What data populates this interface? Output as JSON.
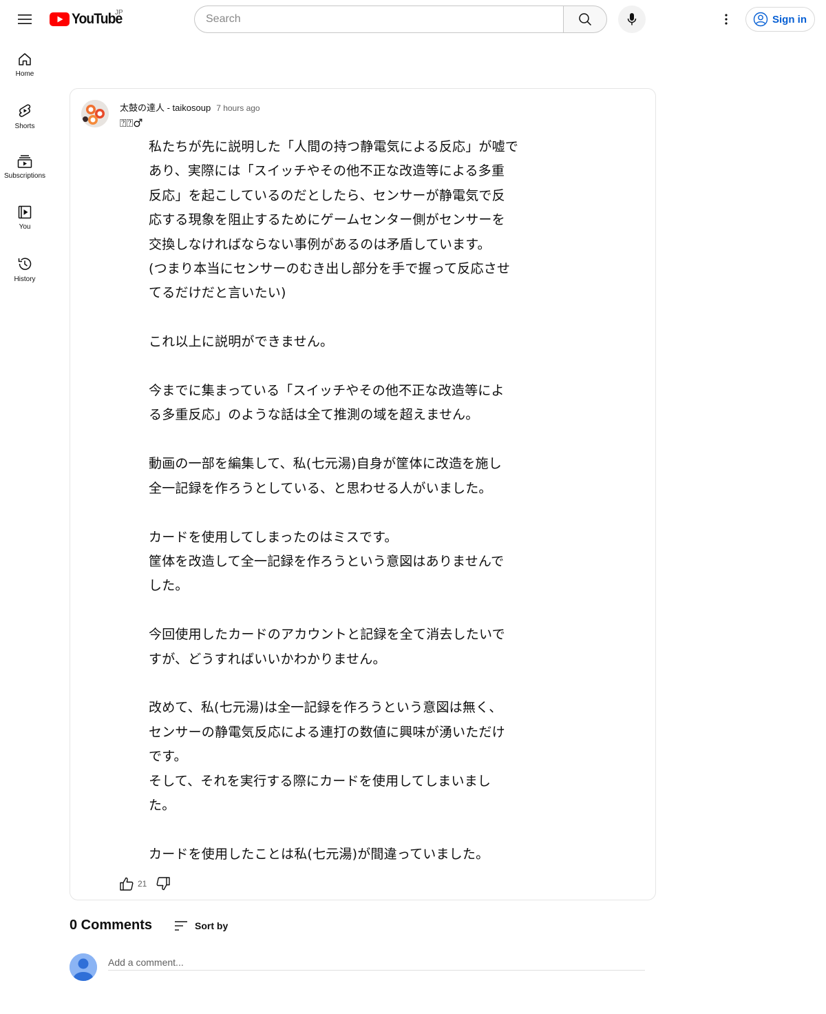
{
  "header": {
    "logo_text": "YouTube",
    "region_code": "JP",
    "search_placeholder": "Search",
    "signin_label": "Sign in"
  },
  "guide": {
    "items": [
      {
        "label": "Home",
        "icon": "home-icon"
      },
      {
        "label": "Shorts",
        "icon": "shorts-icon"
      },
      {
        "label": "Subscriptions",
        "icon": "subscriptions-icon"
      },
      {
        "label": "You",
        "icon": "you-icon"
      },
      {
        "label": "History",
        "icon": "history-icon"
      }
    ]
  },
  "post": {
    "author": "太鼓の達人 - taikosoup",
    "time": "7 hours ago",
    "emoji_line": "⍰⍰♂",
    "body": "私たちが先に説明した「人間の持つ静電気による反応」が嘘で\nあり、実際には「スイッチやその他不正な改造等による多重\n反応」を起こしているのだとしたら、センサーが静電気で反\n応する現象を阻止するためにゲームセンター側がセンサーを\n交換しなければならない事例があるのは矛盾しています。\n(つまり本当にセンサーのむき出し部分を手で握って反応させ\nてるだけだと言いたい)\n\nこれ以上に説明ができません。\n\n今までに集まっている「スイッチやその他不正な改造等によ\nる多重反応」のような話は全て推測の域を超えません。\n\n動画の一部を編集して、私(七元湯)自身が筐体に改造を施し\n全一記録を作ろうとしている、と思わせる人がいました。\n\nカードを使用してしまったのはミスです。\n筐体を改造して全一記録を作ろうという意図はありませんで\nした。\n\n今回使用したカードのアカウントと記録を全て消去したいで\nすが、どうすればいいかわかりません。\n\n改めて、私(七元湯)は全一記録を作ろうという意図は無く、\nセンサーの静電気反応による連打の数値に興味が湧いただけ\nです。\nそして、それを実行する際にカードを使用してしまいまし\nた。\n\nカードを使用したことは私(七元湯)が間違っていました。",
    "like_count": "21"
  },
  "comments": {
    "count_label": "0 Comments",
    "sort_label": "Sort by",
    "add_placeholder": "Add a comment..."
  },
  "colors": {
    "brand_red": "#ff0000",
    "link_blue": "#065fd4",
    "text_primary": "#0f0f0f",
    "text_secondary": "#606060"
  }
}
